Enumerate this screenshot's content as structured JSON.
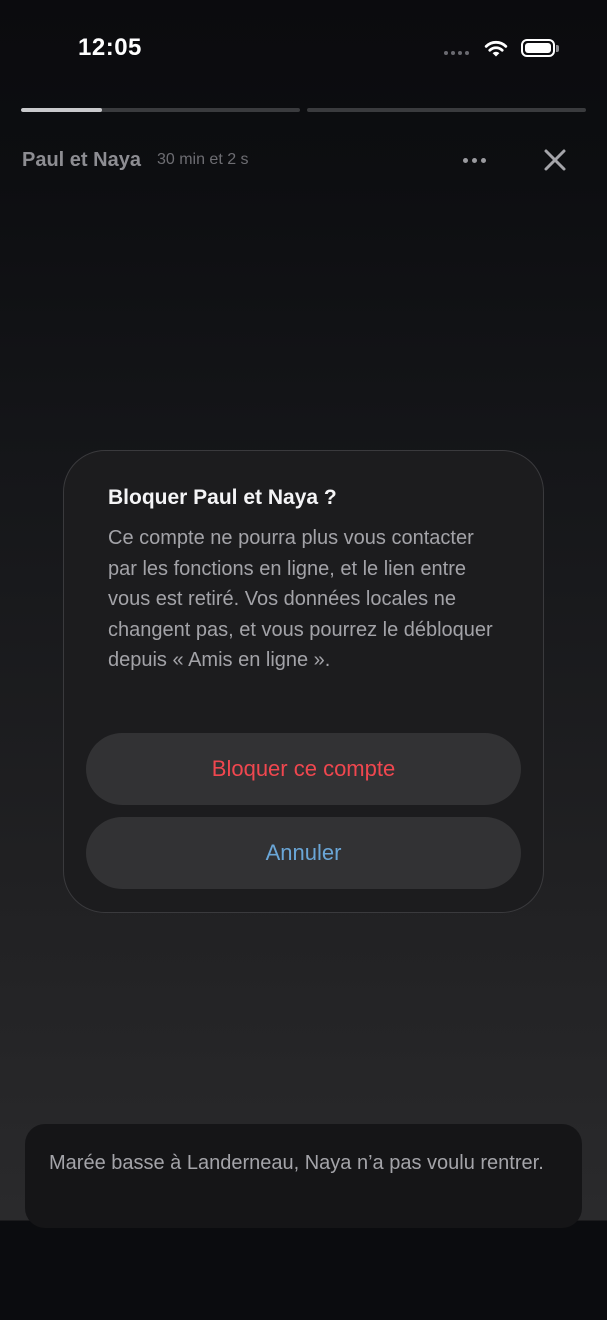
{
  "status_bar": {
    "time": "12:05"
  },
  "story": {
    "progress": [
      0.29,
      0.0
    ],
    "title": "Paul et Naya",
    "duration": "30 min et 2 s",
    "more_icon": "more-horizontal-icon",
    "close_icon": "close-icon"
  },
  "dialog": {
    "title": "Bloquer Paul et Naya ?",
    "message": "Ce compte ne pourra plus vous contacter par les fonctions en ligne, et le lien entre vous est retiré. Vos données locales ne changent pas, et vous pourrez le débloquer depuis « Amis en ligne ».",
    "confirm_label": "Bloquer ce compte",
    "cancel_label": "Annuler"
  },
  "caption": {
    "text": "Marée basse à Landerneau, Naya n’a pas voulu rentrer."
  },
  "colors": {
    "destructive": "#f0474f",
    "accent": "#6aa6d7",
    "dialog_background": "#1c1c1e",
    "button_background": "#323234"
  }
}
